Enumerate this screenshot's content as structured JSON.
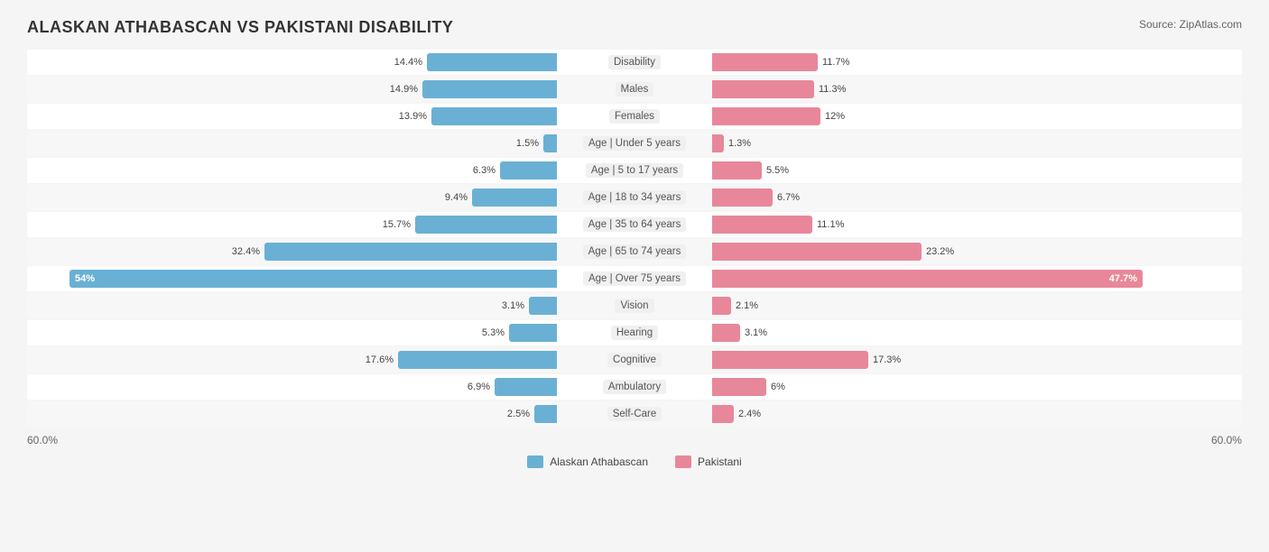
{
  "title": "ALASKAN ATHABASCAN VS PAKISTANI DISABILITY",
  "source": "Source: ZipAtlas.com",
  "xAxisLeft": "60.0%",
  "xAxisRight": "60.0%",
  "legend": {
    "alaskan": "Alaskan Athabascan",
    "pakistani": "Pakistani"
  },
  "rows": [
    {
      "label": "Disability",
      "leftVal": 14.4,
      "rightVal": 11.7,
      "leftPct": 14.4,
      "rightPct": 11.7,
      "leftInside": false,
      "rightInside": false
    },
    {
      "label": "Males",
      "leftVal": 14.9,
      "rightVal": 11.3,
      "leftPct": 14.9,
      "rightPct": 11.3,
      "leftInside": false,
      "rightInside": false
    },
    {
      "label": "Females",
      "leftVal": 13.9,
      "rightVal": 12.0,
      "leftPct": 13.9,
      "rightPct": 12.0,
      "leftInside": false,
      "rightInside": false
    },
    {
      "label": "Age | Under 5 years",
      "leftVal": 1.5,
      "rightVal": 1.3,
      "leftPct": 1.5,
      "rightPct": 1.3,
      "leftInside": false,
      "rightInside": false
    },
    {
      "label": "Age | 5 to 17 years",
      "leftVal": 6.3,
      "rightVal": 5.5,
      "leftPct": 6.3,
      "rightPct": 5.5,
      "leftInside": false,
      "rightInside": false
    },
    {
      "label": "Age | 18 to 34 years",
      "leftVal": 9.4,
      "rightVal": 6.7,
      "leftPct": 9.4,
      "rightPct": 6.7,
      "leftInside": false,
      "rightInside": false
    },
    {
      "label": "Age | 35 to 64 years",
      "leftVal": 15.7,
      "rightVal": 11.1,
      "leftPct": 15.7,
      "rightPct": 11.1,
      "leftInside": false,
      "rightInside": false
    },
    {
      "label": "Age | 65 to 74 years",
      "leftVal": 32.4,
      "rightVal": 23.2,
      "leftPct": 32.4,
      "rightPct": 23.2,
      "leftInside": false,
      "rightInside": false
    },
    {
      "label": "Age | Over 75 years",
      "leftVal": 54.0,
      "rightVal": 47.7,
      "leftPct": 54.0,
      "rightPct": 47.7,
      "leftInside": true,
      "rightInside": true
    },
    {
      "label": "Vision",
      "leftVal": 3.1,
      "rightVal": 2.1,
      "leftPct": 3.1,
      "rightPct": 2.1,
      "leftInside": false,
      "rightInside": false
    },
    {
      "label": "Hearing",
      "leftVal": 5.3,
      "rightVal": 3.1,
      "leftPct": 5.3,
      "rightPct": 3.1,
      "leftInside": false,
      "rightInside": false
    },
    {
      "label": "Cognitive",
      "leftVal": 17.6,
      "rightVal": 17.3,
      "leftPct": 17.6,
      "rightPct": 17.3,
      "leftInside": false,
      "rightInside": false
    },
    {
      "label": "Ambulatory",
      "leftVal": 6.9,
      "rightVal": 6.0,
      "leftPct": 6.9,
      "rightPct": 6.0,
      "leftInside": false,
      "rightInside": false
    },
    {
      "label": "Self-Care",
      "leftVal": 2.5,
      "rightVal": 2.4,
      "leftPct": 2.5,
      "rightPct": 2.4,
      "leftInside": false,
      "rightInside": false
    }
  ],
  "colors": {
    "blue": "#6ab0d4",
    "pink": "#e8879a",
    "blueLabel": "#6ab0d4"
  },
  "maxPct": 60
}
